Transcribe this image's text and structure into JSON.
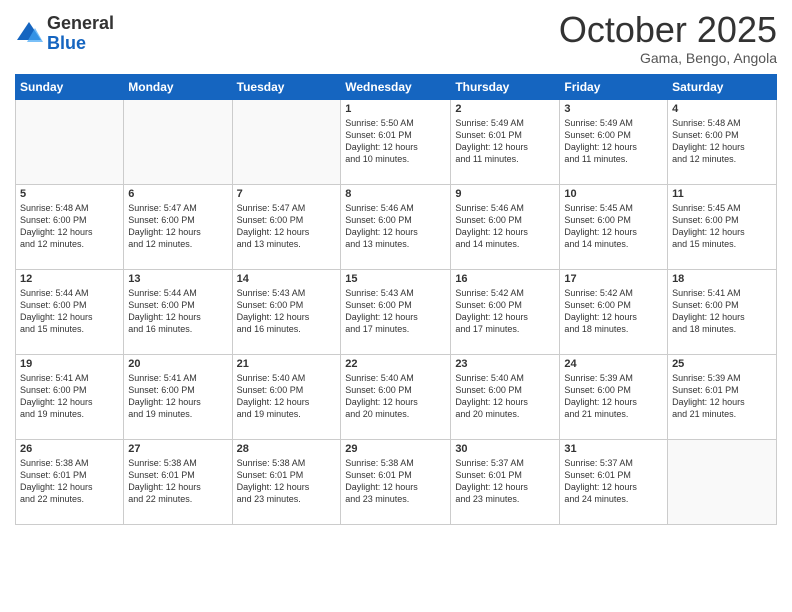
{
  "logo": {
    "general": "General",
    "blue": "Blue"
  },
  "header": {
    "month": "October 2025",
    "location": "Gama, Bengo, Angola"
  },
  "weekdays": [
    "Sunday",
    "Monday",
    "Tuesday",
    "Wednesday",
    "Thursday",
    "Friday",
    "Saturday"
  ],
  "weeks": [
    [
      {
        "day": "",
        "info": ""
      },
      {
        "day": "",
        "info": ""
      },
      {
        "day": "",
        "info": ""
      },
      {
        "day": "1",
        "info": "Sunrise: 5:50 AM\nSunset: 6:01 PM\nDaylight: 12 hours\nand 10 minutes."
      },
      {
        "day": "2",
        "info": "Sunrise: 5:49 AM\nSunset: 6:01 PM\nDaylight: 12 hours\nand 11 minutes."
      },
      {
        "day": "3",
        "info": "Sunrise: 5:49 AM\nSunset: 6:00 PM\nDaylight: 12 hours\nand 11 minutes."
      },
      {
        "day": "4",
        "info": "Sunrise: 5:48 AM\nSunset: 6:00 PM\nDaylight: 12 hours\nand 12 minutes."
      }
    ],
    [
      {
        "day": "5",
        "info": "Sunrise: 5:48 AM\nSunset: 6:00 PM\nDaylight: 12 hours\nand 12 minutes."
      },
      {
        "day": "6",
        "info": "Sunrise: 5:47 AM\nSunset: 6:00 PM\nDaylight: 12 hours\nand 12 minutes."
      },
      {
        "day": "7",
        "info": "Sunrise: 5:47 AM\nSunset: 6:00 PM\nDaylight: 12 hours\nand 13 minutes."
      },
      {
        "day": "8",
        "info": "Sunrise: 5:46 AM\nSunset: 6:00 PM\nDaylight: 12 hours\nand 13 minutes."
      },
      {
        "day": "9",
        "info": "Sunrise: 5:46 AM\nSunset: 6:00 PM\nDaylight: 12 hours\nand 14 minutes."
      },
      {
        "day": "10",
        "info": "Sunrise: 5:45 AM\nSunset: 6:00 PM\nDaylight: 12 hours\nand 14 minutes."
      },
      {
        "day": "11",
        "info": "Sunrise: 5:45 AM\nSunset: 6:00 PM\nDaylight: 12 hours\nand 15 minutes."
      }
    ],
    [
      {
        "day": "12",
        "info": "Sunrise: 5:44 AM\nSunset: 6:00 PM\nDaylight: 12 hours\nand 15 minutes."
      },
      {
        "day": "13",
        "info": "Sunrise: 5:44 AM\nSunset: 6:00 PM\nDaylight: 12 hours\nand 16 minutes."
      },
      {
        "day": "14",
        "info": "Sunrise: 5:43 AM\nSunset: 6:00 PM\nDaylight: 12 hours\nand 16 minutes."
      },
      {
        "day": "15",
        "info": "Sunrise: 5:43 AM\nSunset: 6:00 PM\nDaylight: 12 hours\nand 17 minutes."
      },
      {
        "day": "16",
        "info": "Sunrise: 5:42 AM\nSunset: 6:00 PM\nDaylight: 12 hours\nand 17 minutes."
      },
      {
        "day": "17",
        "info": "Sunrise: 5:42 AM\nSunset: 6:00 PM\nDaylight: 12 hours\nand 18 minutes."
      },
      {
        "day": "18",
        "info": "Sunrise: 5:41 AM\nSunset: 6:00 PM\nDaylight: 12 hours\nand 18 minutes."
      }
    ],
    [
      {
        "day": "19",
        "info": "Sunrise: 5:41 AM\nSunset: 6:00 PM\nDaylight: 12 hours\nand 19 minutes."
      },
      {
        "day": "20",
        "info": "Sunrise: 5:41 AM\nSunset: 6:00 PM\nDaylight: 12 hours\nand 19 minutes."
      },
      {
        "day": "21",
        "info": "Sunrise: 5:40 AM\nSunset: 6:00 PM\nDaylight: 12 hours\nand 19 minutes."
      },
      {
        "day": "22",
        "info": "Sunrise: 5:40 AM\nSunset: 6:00 PM\nDaylight: 12 hours\nand 20 minutes."
      },
      {
        "day": "23",
        "info": "Sunrise: 5:40 AM\nSunset: 6:00 PM\nDaylight: 12 hours\nand 20 minutes."
      },
      {
        "day": "24",
        "info": "Sunrise: 5:39 AM\nSunset: 6:00 PM\nDaylight: 12 hours\nand 21 minutes."
      },
      {
        "day": "25",
        "info": "Sunrise: 5:39 AM\nSunset: 6:01 PM\nDaylight: 12 hours\nand 21 minutes."
      }
    ],
    [
      {
        "day": "26",
        "info": "Sunrise: 5:38 AM\nSunset: 6:01 PM\nDaylight: 12 hours\nand 22 minutes."
      },
      {
        "day": "27",
        "info": "Sunrise: 5:38 AM\nSunset: 6:01 PM\nDaylight: 12 hours\nand 22 minutes."
      },
      {
        "day": "28",
        "info": "Sunrise: 5:38 AM\nSunset: 6:01 PM\nDaylight: 12 hours\nand 23 minutes."
      },
      {
        "day": "29",
        "info": "Sunrise: 5:38 AM\nSunset: 6:01 PM\nDaylight: 12 hours\nand 23 minutes."
      },
      {
        "day": "30",
        "info": "Sunrise: 5:37 AM\nSunset: 6:01 PM\nDaylight: 12 hours\nand 23 minutes."
      },
      {
        "day": "31",
        "info": "Sunrise: 5:37 AM\nSunset: 6:01 PM\nDaylight: 12 hours\nand 24 minutes."
      },
      {
        "day": "",
        "info": ""
      }
    ]
  ]
}
